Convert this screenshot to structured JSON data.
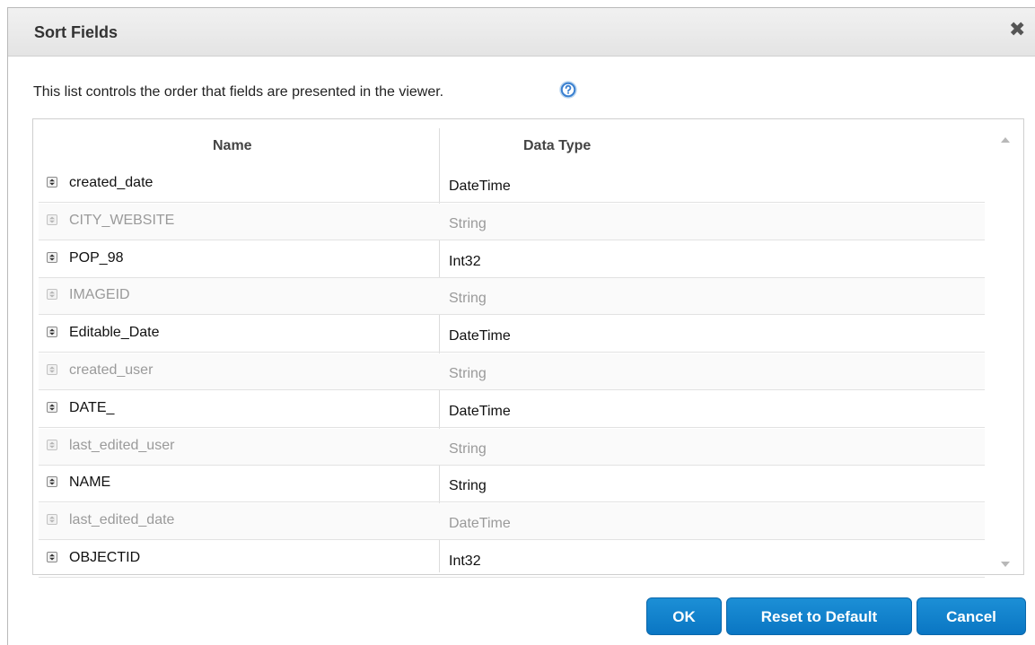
{
  "dialog": {
    "title": "Sort Fields",
    "close_label": "✖",
    "description": "This list controls the order that fields are presented in the viewer.",
    "help_icon": "question-circle-icon"
  },
  "table": {
    "columns": [
      "Name",
      "Data Type"
    ],
    "rows": [
      {
        "name": "created_date",
        "type": "DateTime",
        "enabled": true
      },
      {
        "name": "CITY_WEBSITE",
        "type": "String",
        "enabled": false
      },
      {
        "name": "POP_98",
        "type": "Int32",
        "enabled": true
      },
      {
        "name": "IMAGEID",
        "type": "String",
        "enabled": false
      },
      {
        "name": "Editable_Date",
        "type": "DateTime",
        "enabled": true
      },
      {
        "name": "created_user",
        "type": "String",
        "enabled": false
      },
      {
        "name": "DATE_",
        "type": "DateTime",
        "enabled": true
      },
      {
        "name": "last_edited_user",
        "type": "String",
        "enabled": false
      },
      {
        "name": "NAME",
        "type": "String",
        "enabled": true
      },
      {
        "name": "last_edited_date",
        "type": "DateTime",
        "enabled": false
      },
      {
        "name": "OBJECTID",
        "type": "Int32",
        "enabled": true
      }
    ]
  },
  "buttons": {
    "ok": "OK",
    "reset": "Reset to Default",
    "cancel": "Cancel"
  },
  "colors": {
    "button": "#0a76c3",
    "disabled_text": "#9a9a9a"
  }
}
